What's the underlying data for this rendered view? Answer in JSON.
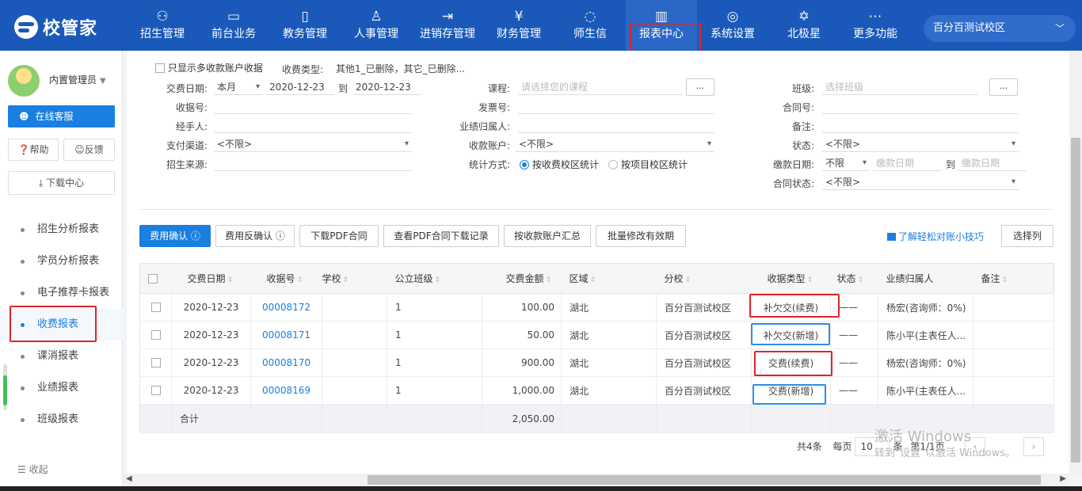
{
  "brand": {
    "name": "校管家"
  },
  "nav": [
    {
      "label": "招生管理",
      "icon": "person-add-icon",
      "glyph": "⚇"
    },
    {
      "label": "前台业务",
      "icon": "monitor-icon",
      "glyph": "▭"
    },
    {
      "label": "教务管理",
      "icon": "book-icon",
      "glyph": "▯"
    },
    {
      "label": "人事管理",
      "icon": "person-icon",
      "glyph": "♙"
    },
    {
      "label": "进销存管理",
      "icon": "login-box-icon",
      "glyph": "⇥"
    },
    {
      "label": "财务管理",
      "icon": "yen-shield-icon",
      "glyph": "¥"
    },
    {
      "label": "师生信",
      "icon": "chat-icon",
      "glyph": "◌"
    },
    {
      "label": "报表中心",
      "icon": "bar-chart-icon",
      "glyph": "▥"
    },
    {
      "label": "系统设置",
      "icon": "settings-icon",
      "glyph": "◎"
    },
    {
      "label": "北极星",
      "icon": "star-icon",
      "glyph": "✡"
    },
    {
      "label": "更多功能",
      "icon": "more-icon",
      "glyph": "⋯"
    }
  ],
  "campus": {
    "label": "百分百测试校区"
  },
  "user": {
    "name": "内置管理员"
  },
  "sidebar": {
    "service": "在线客服",
    "help": "帮助",
    "feedback": "反馈",
    "download": "下载中心",
    "items": [
      "招生分析报表",
      "学员分析报表",
      "电子推荐卡报表",
      "收费报表",
      "课消报表",
      "业绩报表",
      "班级报表"
    ],
    "collapse": "收起"
  },
  "filters": {
    "only_multi_account": "只显示多收款账户收据",
    "receipt_type_label": "收费类型:",
    "receipt_type_value": "其他1_已删除，其它_已删除...",
    "pay_date_label": "交费日期:",
    "pay_date_range": "本月",
    "date_from": "2020-12-23",
    "to": "到",
    "date_to": "2020-12-23",
    "course_label": "课程:",
    "course_placeholder": "请选择您的课程",
    "class_label": "班级:",
    "class_placeholder": "选择班级",
    "dots": "...",
    "receipt_no_label": "收据号:",
    "invoice_no_label": "发票号:",
    "contract_no_label": "合同号:",
    "handler_label": "经手人:",
    "perf_owner_label": "业绩归属人:",
    "remark_label": "备注:",
    "channel_label": "支付渠道:",
    "channel_value": "<不限>",
    "account_label": "收款账户:",
    "account_value": "<不限>",
    "status_label": "状态:",
    "status_value": "<不限>",
    "source_label": "招生来源:",
    "stat_mode_label": "统计方式:",
    "stat_mode_a": "按收费校区统计",
    "stat_mode_b": "按项目校区统计",
    "pay_day_label": "缴款日期:",
    "pay_day_range": "不限",
    "pay_day_placeholder": "缴款日期",
    "contract_status_label": "合同状态:",
    "contract_status_value": "<不限>"
  },
  "actions": {
    "confirm": "费用确认",
    "unconfirm": "费用反确认",
    "download_pdf": "下载PDF合同",
    "pdf_log": "查看PDF合同下载记录",
    "by_account": "按收款账户汇总",
    "batch_validity": "批量修改有效期",
    "tip": "了解轻松对账小技巧",
    "select_columns": "选择列"
  },
  "table": {
    "headers": [
      "交费日期",
      "收据号",
      "学校",
      "公立班级",
      "交费金额",
      "区域",
      "分校",
      "收据类型",
      "状态",
      "业绩归属人",
      "备注"
    ],
    "rows": [
      {
        "date": "2020-12-23",
        "no": "00008172",
        "cls": "1",
        "amount": "100.00",
        "region": "湖北",
        "branch": "百分百测试校区",
        "type": "补欠交(续费)",
        "status": "——",
        "owner": "杨宏(咨询师：0%)"
      },
      {
        "date": "2020-12-23",
        "no": "00008171",
        "cls": "1",
        "amount": "50.00",
        "region": "湖北",
        "branch": "百分百测试校区",
        "type": "补欠交(新增)",
        "status": "——",
        "owner": "陈小平(主表任人..."
      },
      {
        "date": "2020-12-23",
        "no": "00008170",
        "cls": "1",
        "amount": "900.00",
        "region": "湖北",
        "branch": "百分百测试校区",
        "type": "交费(续费)",
        "status": "——",
        "owner": "杨宏(咨询师：0%)"
      },
      {
        "date": "2020-12-23",
        "no": "00008169",
        "cls": "1",
        "amount": "1,000.00",
        "region": "湖北",
        "branch": "百分百测试校区",
        "type": "交费(新增)",
        "status": "——",
        "owner": "陈小平(主表任人..."
      }
    ],
    "sum_label": "合计",
    "sum_amount": "2,050.00"
  },
  "pager": {
    "total": "共4条",
    "per_page_label": "每页",
    "per_page": "10",
    "unit": "条",
    "page": "第1/1页"
  },
  "watermark": {
    "line1": "激活 Windows",
    "line2": "转到\"设置\"以激活 Windows。"
  }
}
